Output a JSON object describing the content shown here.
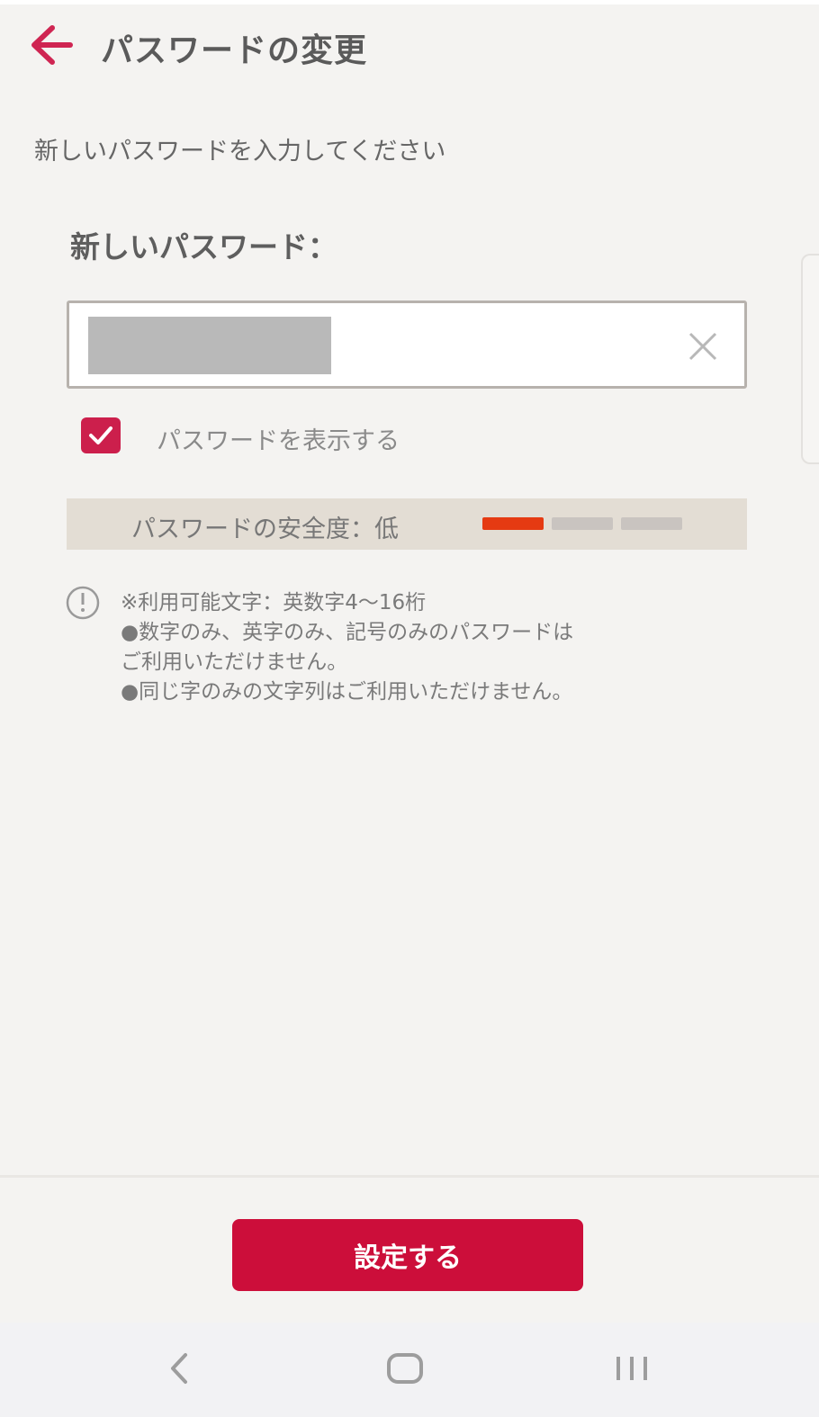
{
  "header": {
    "back_icon": "arrow-left-icon",
    "title": "パスワードの変更"
  },
  "instruction": "新しいパスワードを入力してください",
  "password_field": {
    "label": "新しいパスワード：",
    "value": "••••••••",
    "clear_icon": "close-icon"
  },
  "show_password": {
    "label": "パスワードを表示する",
    "checked": true
  },
  "strength": {
    "label": "パスワードの安全度：低",
    "level_fraction": 0.33
  },
  "notes": {
    "icon": "info-icon",
    "lines": [
      "※利用可能文字：英数字4〜16桁",
      "●数字のみ、英字のみ、記号のみのパスワードはご利用いただけません。",
      "●同じ字のみの文字列はご利用いただけません。"
    ]
  },
  "submit": {
    "label": "設定する"
  },
  "system_nav": {
    "back_icon": "nav-back-icon",
    "home_icon": "nav-home-icon",
    "recents_icon": "nav-recents-icon"
  },
  "colors": {
    "accent": "#cc0e3a",
    "checkbox": "#cc1f4c",
    "strength_low": "#e53a12",
    "strength_empty": "#c9c4c0",
    "strength_bg": "#e3ddd4",
    "background": "#f4f3f1"
  }
}
